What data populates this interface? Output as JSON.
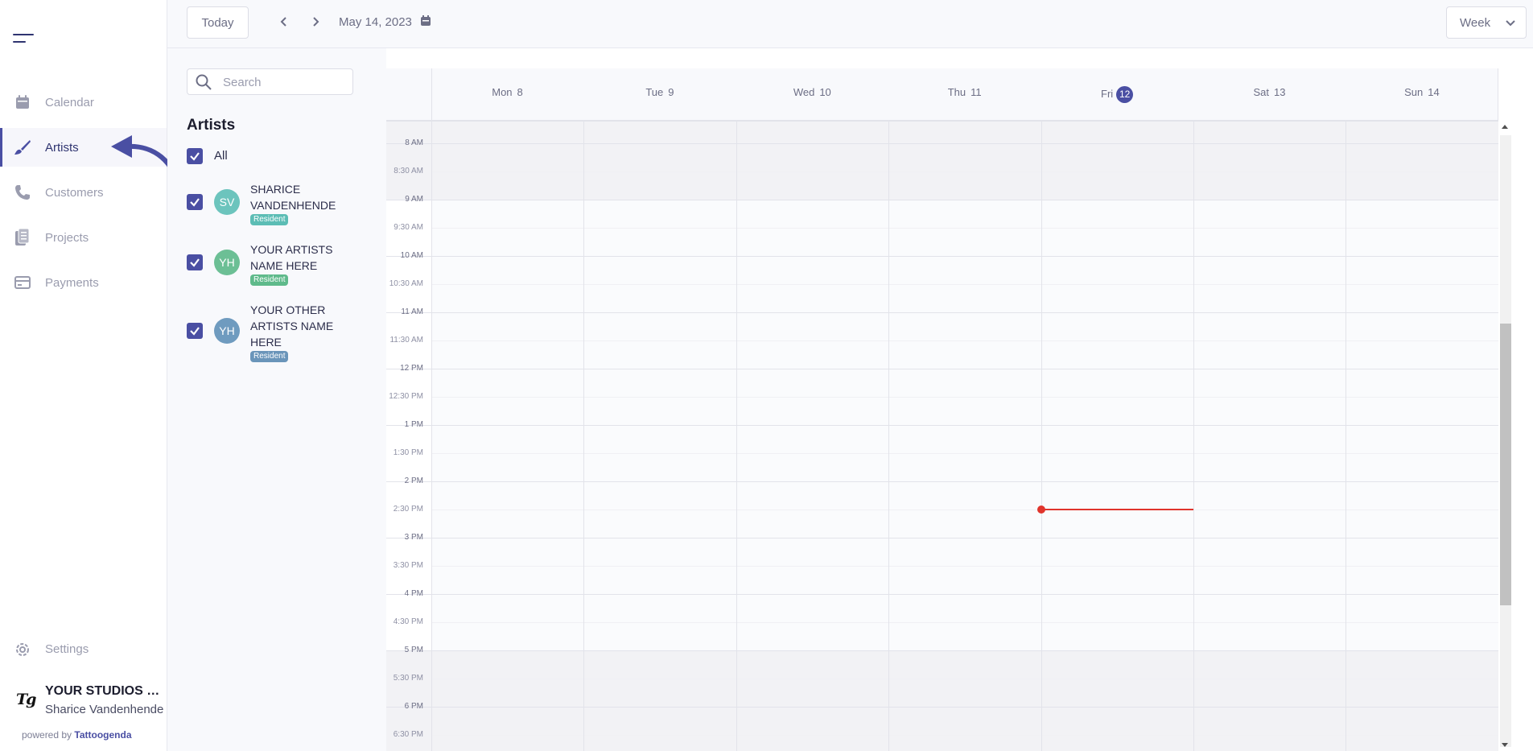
{
  "sidebar": {
    "items": [
      {
        "label": "Calendar",
        "icon": "calendar-icon"
      },
      {
        "label": "Artists",
        "icon": "brush-icon",
        "active": true
      },
      {
        "label": "Customers",
        "icon": "phone-icon"
      },
      {
        "label": "Projects",
        "icon": "documents-icon"
      },
      {
        "label": "Payments",
        "icon": "card-icon"
      }
    ],
    "settings_label": "Settings",
    "studio_name": "YOUR STUDIOS NAME",
    "user_name": "Sharice Vandenhende",
    "logo_text": "Tg",
    "powered_prefix": "powered by",
    "powered_brand": "Tattoogenda"
  },
  "toolbar": {
    "today_label": "Today",
    "date_label": "May 14, 2023",
    "view_label": "Week"
  },
  "filter": {
    "search_placeholder": "Search",
    "heading": "Artists",
    "all_label": "All",
    "artists": [
      {
        "initials": "SV",
        "name": "SHARICE VANDENHENDE",
        "badge": "Resident",
        "color": "#6cc4bd",
        "checked": true
      },
      {
        "initials": "YH",
        "name": "YOUR ARTISTS NAME HERE",
        "badge": "Resident",
        "color": "#6cbf95",
        "checked": true
      },
      {
        "initials": "YH",
        "name": "YOUR OTHER ARTISTS NAME HERE",
        "badge": "Resident",
        "color": "#6f9bbf",
        "checked": true
      }
    ]
  },
  "calendar": {
    "days": [
      {
        "name": "Mon",
        "num": "8"
      },
      {
        "name": "Tue",
        "num": "9"
      },
      {
        "name": "Wed",
        "num": "10"
      },
      {
        "name": "Thu",
        "num": "11"
      },
      {
        "name": "Fri",
        "num": "12",
        "today": true
      },
      {
        "name": "Sat",
        "num": "13"
      },
      {
        "name": "Sun",
        "num": "14"
      }
    ],
    "times": [
      "8 AM",
      "8:30 AM",
      "9 AM",
      "9:30 AM",
      "10 AM",
      "10:30 AM",
      "11 AM",
      "11:30 AM",
      "12 PM",
      "12:30 PM",
      "1 PM",
      "1:30 PM",
      "2 PM",
      "2:30 PM",
      "3 PM",
      "3:30 PM",
      "4 PM",
      "4:30 PM",
      "5 PM",
      "5:30 PM",
      "6 PM",
      "6:30 PM"
    ],
    "business_hours": {
      "start": "9 AM",
      "end": "5 PM"
    },
    "now_indicator": {
      "day": "Fri",
      "time": "2:30 PM"
    },
    "accent_color": "#4a4fa3",
    "now_color": "#e0342c"
  }
}
